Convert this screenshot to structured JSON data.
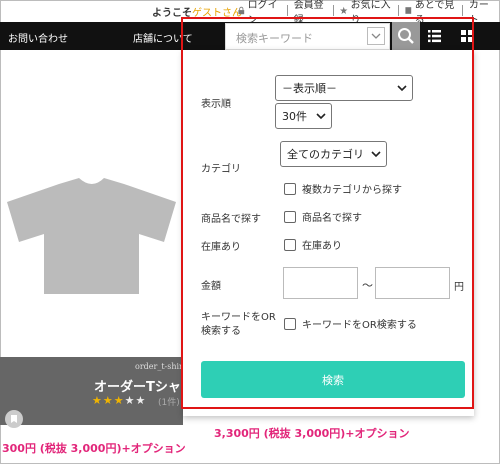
{
  "topbar": {
    "welcome_prefix": "ようこそ",
    "guest": "ゲストさん",
    "links": [
      {
        "label": "ログイン",
        "icon": "lock-icon"
      },
      {
        "label": "会員登録",
        "icon": ""
      },
      {
        "label": "お気に入り",
        "icon": "star-icon"
      },
      {
        "label": "あとで見る",
        "icon": "bookmark-icon"
      },
      {
        "label": "カート",
        "icon": ""
      }
    ]
  },
  "nav": {
    "contact": "お問い合わせ",
    "stores": "店舗について",
    "search_placeholder": "検索キーワード"
  },
  "product": {
    "code": "order_t-shirt",
    "name": "オーダーTシャツ",
    "rating": 3,
    "rating_max": 5,
    "reviews": "(1件)",
    "price1": "300円 (税抜 3,000円)+オプション",
    "price2": "3,300円 (税抜 3,000円)+オプション"
  },
  "search_panel": {
    "sort_label": "表示順",
    "sort_value": "－表示順－",
    "per_page_value": "30件",
    "category_label": "カテゴリ",
    "category_value": "全てのカテゴリ",
    "multi_category": "複数カテゴリから探す",
    "product_name_label": "商品名で探す",
    "product_name_cb": "商品名で探す",
    "in_stock_label": "在庫あり",
    "in_stock_cb": "在庫あり",
    "price_label": "金額",
    "tilde": "～",
    "yen": "円",
    "keyword_or_label_1": "キーワードをOR",
    "keyword_or_label_2": "検索する",
    "keyword_or_cb": "キーワードをOR検索する",
    "submit": "検索"
  },
  "colors": {
    "accent": "#2ecfb5",
    "highlight_border": "#e01515",
    "price": "#e2267a",
    "nav_bg": "#111111"
  }
}
